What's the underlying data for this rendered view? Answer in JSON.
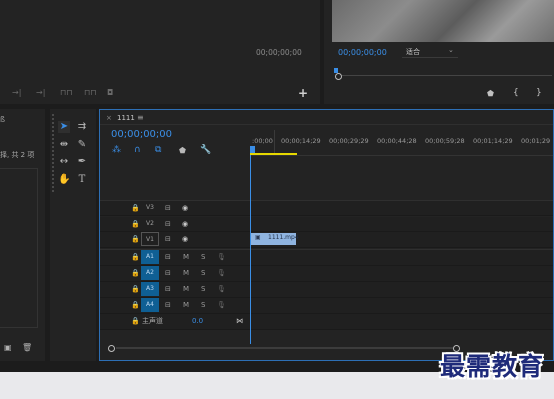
{
  "source": {
    "timecode": "00;00;00;00",
    "add_icon": "+"
  },
  "program": {
    "timecode": "00;00;00;00",
    "fit_select": "适合"
  },
  "project": {
    "item_count_text": "择, 共 2 项"
  },
  "timeline": {
    "tab_label": "1111",
    "menu_icon": "≡",
    "close_icon": "×",
    "timecode": "00;00;00;00",
    "ruler_labels": [
      ":00;00",
      "00;00;14;29",
      "00;00;29;29",
      "00;00;44;28",
      "00;00;59;28",
      "00;01;14;29",
      "00;01;29"
    ],
    "video_tracks": [
      "V3",
      "V2",
      "V1"
    ],
    "audio_tracks": [
      "A1",
      "A2",
      "A3",
      "A4"
    ],
    "mute_label": "M",
    "solo_label": "S",
    "master_label": "主声道",
    "master_value": "0.0",
    "clip_label": "1111.mp4"
  },
  "watermark": "最需教育",
  "colors": {
    "accent": "#3a8ee6",
    "track_active": "#0f5f94",
    "clip": "#8fb4e0",
    "work_area": "#e6d800",
    "panel": "#232323"
  }
}
